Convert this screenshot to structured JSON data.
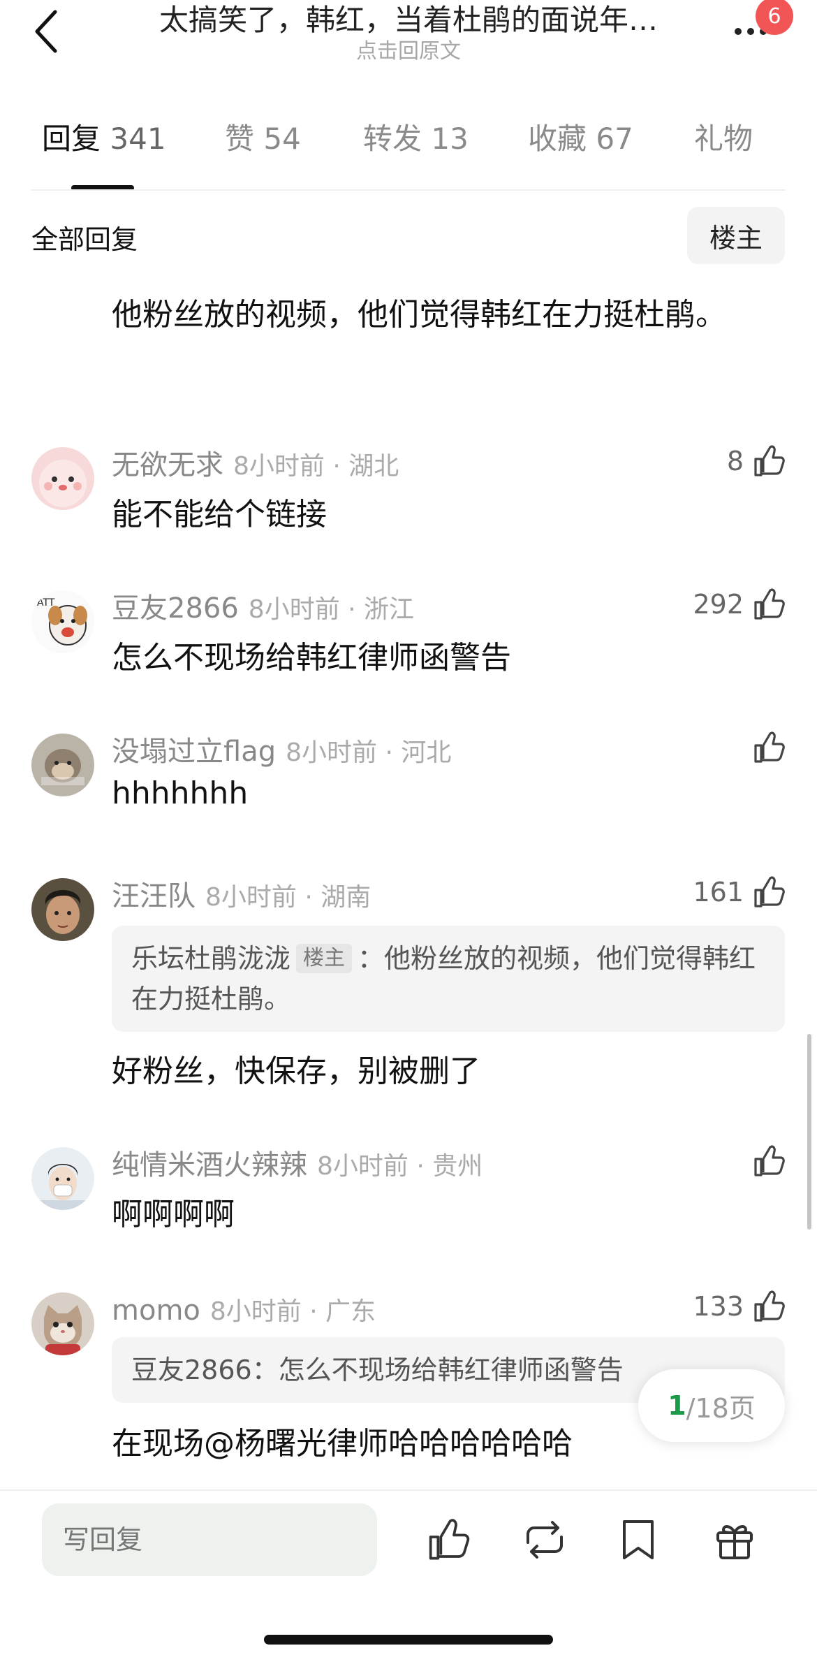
{
  "header": {
    "title": "太搞笑了，韩红，当着杜鹃的面说年…",
    "subtitle": "点击回原文",
    "badge_count": "6"
  },
  "tabs": [
    {
      "label": "回复",
      "count": "341"
    },
    {
      "label": "赞",
      "count": "54"
    },
    {
      "label": "转发",
      "count": "13"
    },
    {
      "label": "收藏",
      "count": "67"
    },
    {
      "label": "礼物",
      "count": ""
    }
  ],
  "section": {
    "title": "全部回复",
    "filter_label": "楼主"
  },
  "partial_comment": {
    "text": "他粉丝放的视频，他们觉得韩红在力挺杜鹃。"
  },
  "comments": [
    {
      "name": "无欲无求",
      "meta": "8小时前 · 湖北",
      "likes": "8",
      "text": "能不能给个链接"
    },
    {
      "name": "豆友2866",
      "meta": "8小时前 · 浙江",
      "likes": "292",
      "text": "怎么不现场给韩红律师函警告"
    },
    {
      "name": "没塌过立flag",
      "meta": "8小时前 · 河北",
      "likes": "",
      "text": "hhhhhhh"
    },
    {
      "name": "汪汪队",
      "meta": "8小时前 · 湖南",
      "likes": "161",
      "text": "好粉丝，快保存，别被删了",
      "quote": {
        "name": "乐坛杜鹃泷泷",
        "tag": "楼主",
        "sep": "：",
        "text": "他粉丝放的视频，他们觉得韩红在力挺杜鹃。"
      }
    },
    {
      "name": "纯情米酒火辣辣",
      "meta": "8小时前 · 贵州",
      "likes": "",
      "text": "啊啊啊啊"
    },
    {
      "name": "momo",
      "meta": "8小时前 · 广东",
      "likes": "133",
      "text": "在现场@杨曙光律师哈哈哈哈哈哈",
      "quote": {
        "name": "豆友2866",
        "sep": "：",
        "text": "怎么不现场给韩红律师函警告"
      }
    }
  ],
  "pagination": {
    "current": "1",
    "total_label": "/18页"
  },
  "bottom_bar": {
    "reply_placeholder": "写回复"
  },
  "colors": {
    "accent_green": "#1a9b48",
    "badge_red": "#f25555"
  }
}
